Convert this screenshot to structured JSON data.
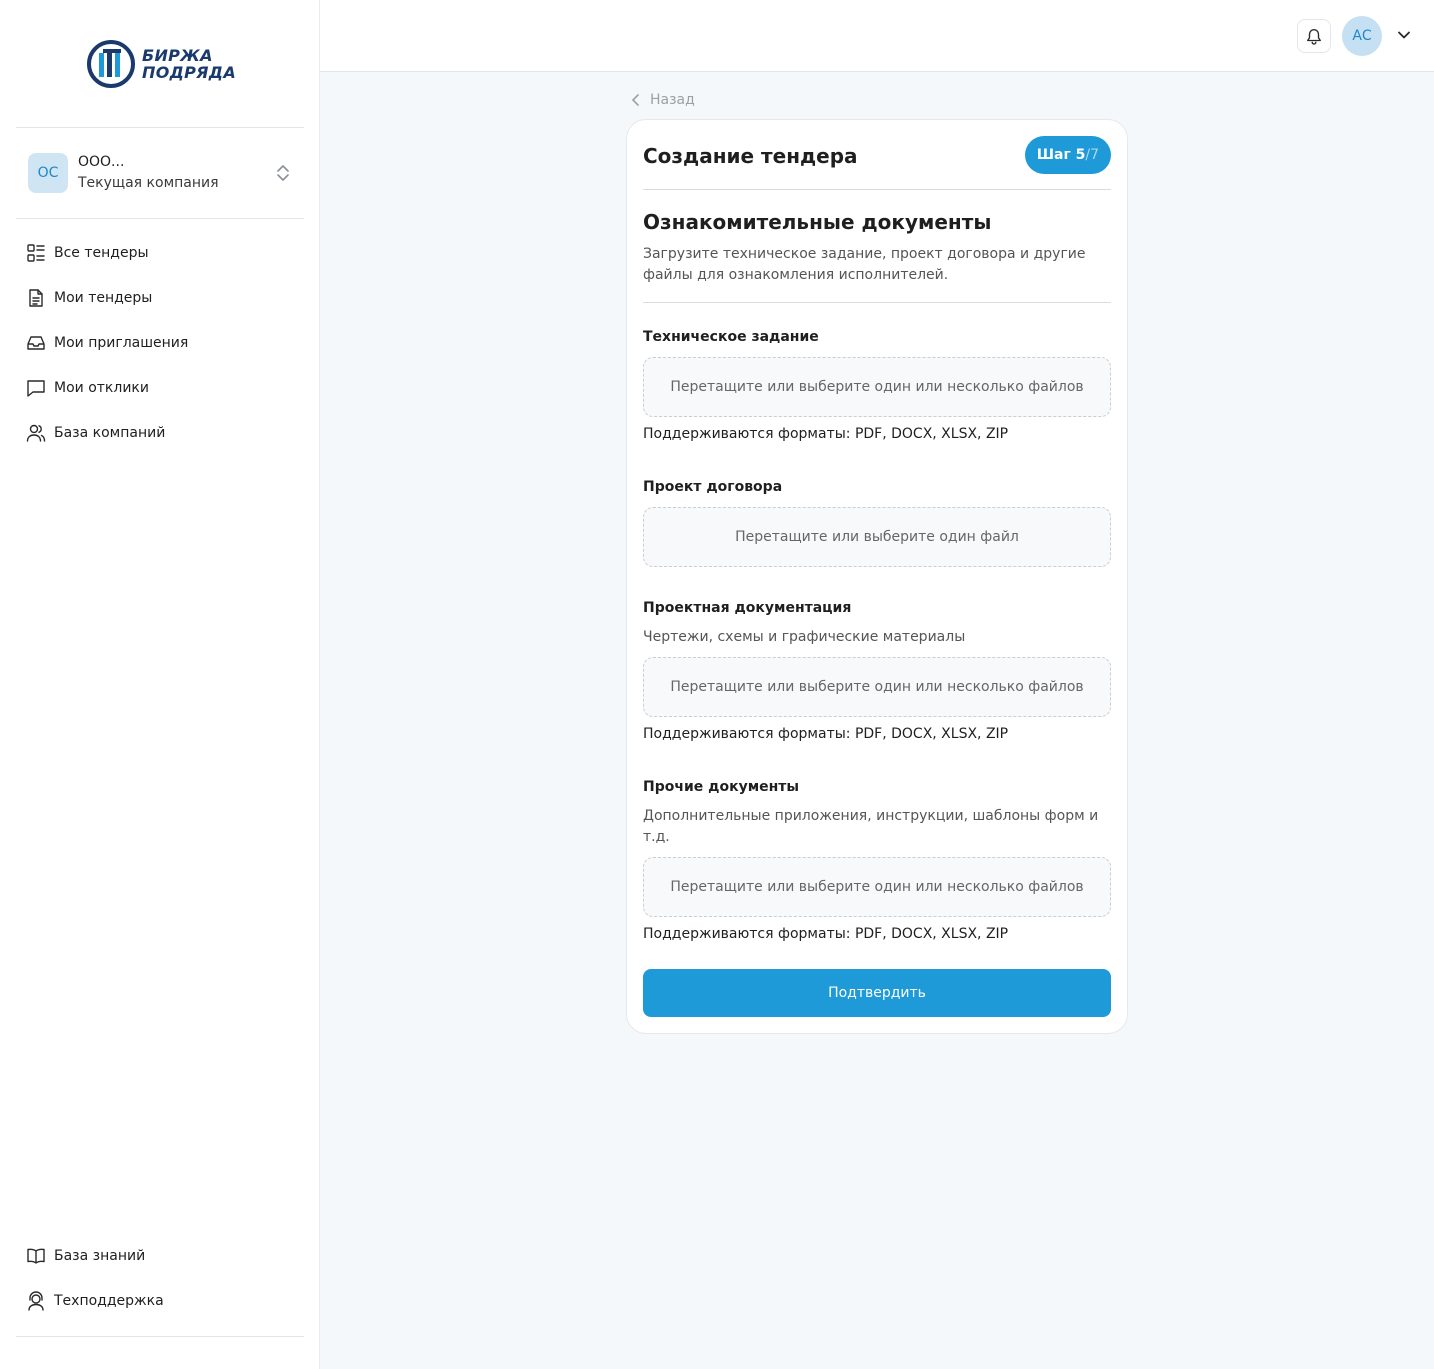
{
  "brand": {
    "line1": "БИРЖА",
    "line2": "ПОДРЯДА"
  },
  "company": {
    "initials": "ОС",
    "name": "ООО...",
    "subtitle": "Текущая компания"
  },
  "nav": {
    "items": [
      {
        "label": "Все тендеры",
        "icon": "list-icon"
      },
      {
        "label": "Мои тендеры",
        "icon": "document-icon"
      },
      {
        "label": "Мои приглашения",
        "icon": "inbox-icon"
      },
      {
        "label": "Мои отклики",
        "icon": "chat-icon"
      },
      {
        "label": "База компаний",
        "icon": "users-icon"
      }
    ],
    "bottom": [
      {
        "label": "База знаний",
        "icon": "book-icon"
      },
      {
        "label": "Техподдержка",
        "icon": "support-icon"
      }
    ]
  },
  "header": {
    "user_initials": "АС"
  },
  "back_label": "Назад",
  "card": {
    "title": "Создание тендера",
    "step_label": "Шаг 5",
    "step_total": "/7",
    "section_title": "Ознакомительные документы",
    "section_desc": "Загрузите техническое задание, проект договора и другие файлы для ознакомления исполнителей.",
    "fields": [
      {
        "label": "Техническое задание",
        "hint": "",
        "dropzone": "Перетащите или выберите один или несколько файлов",
        "formats": "Поддерживаются форматы: PDF, DOCX, XLSX, ZIP"
      },
      {
        "label": "Проект договора",
        "hint": "",
        "dropzone": "Перетащите или выберите один файл",
        "formats": ""
      },
      {
        "label": "Проектная документация",
        "hint": "Чертежи, схемы и графические материалы",
        "dropzone": "Перетащите или выберите один или несколько файлов",
        "formats": "Поддерживаются форматы: PDF, DOCX, XLSX, ZIP"
      },
      {
        "label": "Прочие документы",
        "hint": "Дополнительные приложения, инструкции, шаблоны форм и т.д.",
        "dropzone": "Перетащите или выберите один или несколько файлов",
        "formats": "Поддерживаются форматы: PDF, DOCX, XLSX, ZIP"
      }
    ],
    "confirm_label": "Подтвердить"
  },
  "colors": {
    "accent": "#1e9ad8",
    "brand_dark": "#1a3a6e",
    "avatar_bg": "#cfe5f4"
  }
}
